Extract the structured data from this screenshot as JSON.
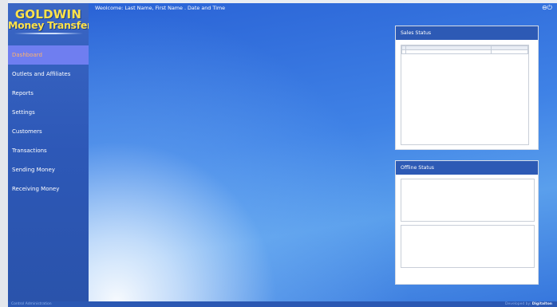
{
  "header": {
    "welcome_text": "Weolcome: Last Name, First Name . Date and Time",
    "window_controls": "⊖⏻"
  },
  "logo": {
    "title": "GOLDWIN",
    "subtitle": "Money Transfer"
  },
  "sidebar": {
    "items": [
      {
        "label": "Dashboard",
        "active": true
      },
      {
        "label": "Outlets and Affiliates",
        "active": false
      },
      {
        "label": "Reports",
        "active": false
      },
      {
        "label": "Settings",
        "active": false
      },
      {
        "label": "Customers",
        "active": false
      },
      {
        "label": "Transactions",
        "active": false
      },
      {
        "label": "Sending Money",
        "active": false
      },
      {
        "label": "Receiving Money",
        "active": false
      }
    ]
  },
  "panels": {
    "sales_status_title": "Sales Status",
    "offline_status_title": "Offline Status"
  },
  "footer": {
    "left_text": "Control Administration",
    "right_prefix": "Developed by:",
    "right_brand": "Digitalton"
  },
  "colors": {
    "sidebar_bg": "#2d58b7",
    "active_item_bg": "#6f7ef0",
    "active_item_text": "#ffb16b",
    "panel_header": "#2d5ab5",
    "logo_text": "#ffe24a"
  }
}
